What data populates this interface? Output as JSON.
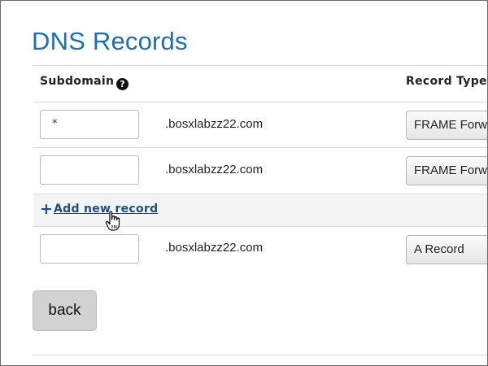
{
  "page": {
    "title": "DNS Records"
  },
  "table": {
    "headers": {
      "subdomain": "Subdomain",
      "record_type": "Record Type"
    },
    "help_icon": "question-circle-icon",
    "rows": [
      {
        "subdomain_value": "*",
        "domain": ".bosxlabzz22.com",
        "record_type": "FRAME Forwarding"
      },
      {
        "subdomain_value": "",
        "domain": ".bosxlabzz22.com",
        "record_type": "FRAME Forwarding"
      },
      {
        "subdomain_value": "",
        "domain": ".bosxlabzz22.com",
        "record_type": "A Record"
      }
    ],
    "add_record_label": "Add new record",
    "add_record_icon": "plus-icon"
  },
  "actions": {
    "back_label": "back"
  },
  "cursor": "hand-pointer-icon"
}
